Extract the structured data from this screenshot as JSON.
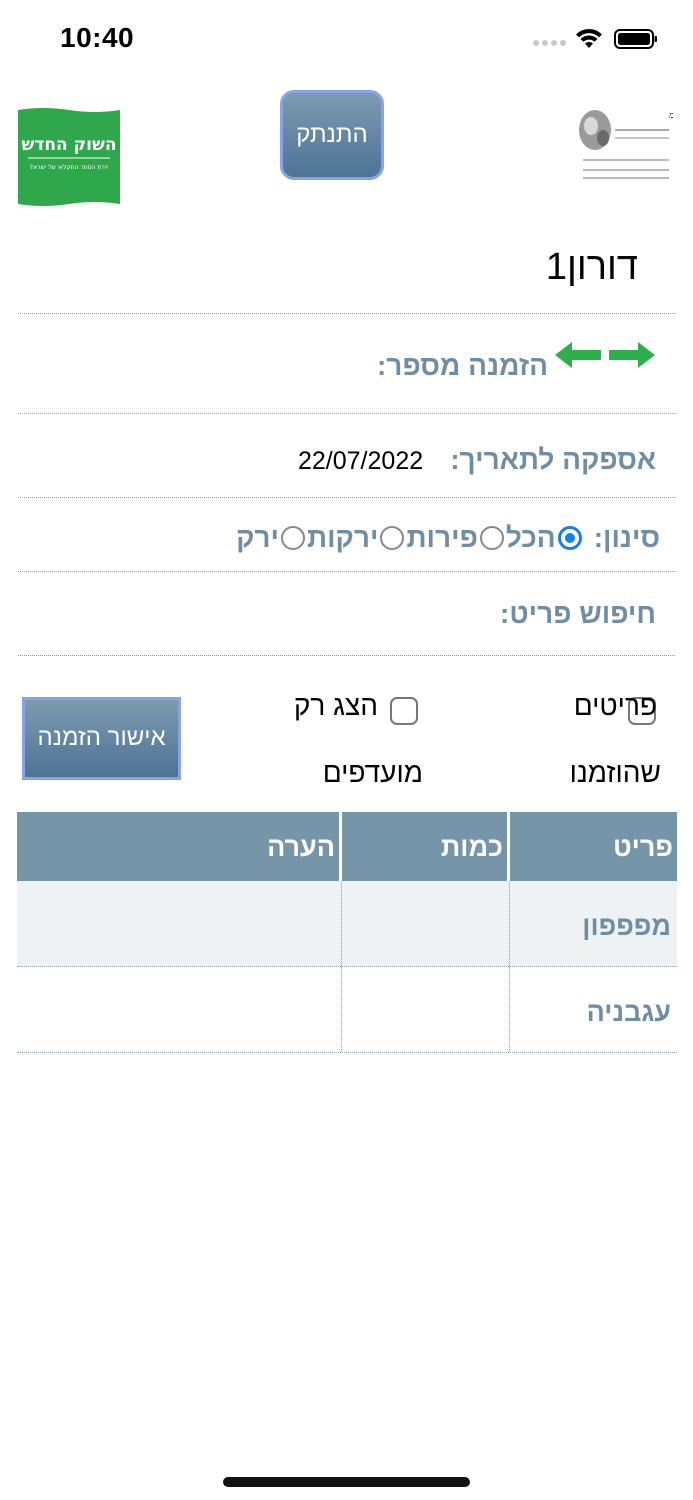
{
  "status_bar": {
    "time": "10:40"
  },
  "header": {
    "disconnect_label": "התנתק",
    "logo_right_title": "השוק החדש",
    "logo_right_subtitle": "זירת הסחר החקלאי של ישראל",
    "logo_left_title": "י.מ. שיווק ירקות בע\"מ"
  },
  "user": {
    "name": "דורון1"
  },
  "order": {
    "label": "הזמנה מספר:"
  },
  "delivery": {
    "label": "אספקה לתאריך:",
    "date": "22/07/2022"
  },
  "filter": {
    "label": "סינון:",
    "options": [
      {
        "label": "הכל",
        "selected": true
      },
      {
        "label": "פירות",
        "selected": false
      },
      {
        "label": "ירקות",
        "selected": false
      },
      {
        "label": "ירק",
        "selected": false
      }
    ]
  },
  "search": {
    "label": "חיפוש פריט:"
  },
  "checkboxes": {
    "ordered_line1": "פריטים",
    "ordered_line2": "שהוזמנו",
    "favorites_line1": "הצג רק",
    "favorites_line2": "מועדפים"
  },
  "confirm_button": {
    "label": "אישור הזמנה"
  },
  "table": {
    "headers": [
      "פריט",
      "כמות",
      "הערה"
    ],
    "rows": [
      {
        "item": "מפפפון",
        "quantity": "",
        "note": ""
      },
      {
        "item": "עגבניה",
        "quantity": "",
        "note": ""
      }
    ]
  },
  "colors": {
    "accent": "#6f8ea6",
    "header_bg": "#7596a8",
    "radio_selected": "#1a7cf5",
    "arrow_green": "#2db04b",
    "logo_green": "#2ea84a"
  },
  "icons": [
    "wifi-icon",
    "battery-icon",
    "signal-icon",
    "arrow-left-icon",
    "arrow-right-icon"
  ]
}
